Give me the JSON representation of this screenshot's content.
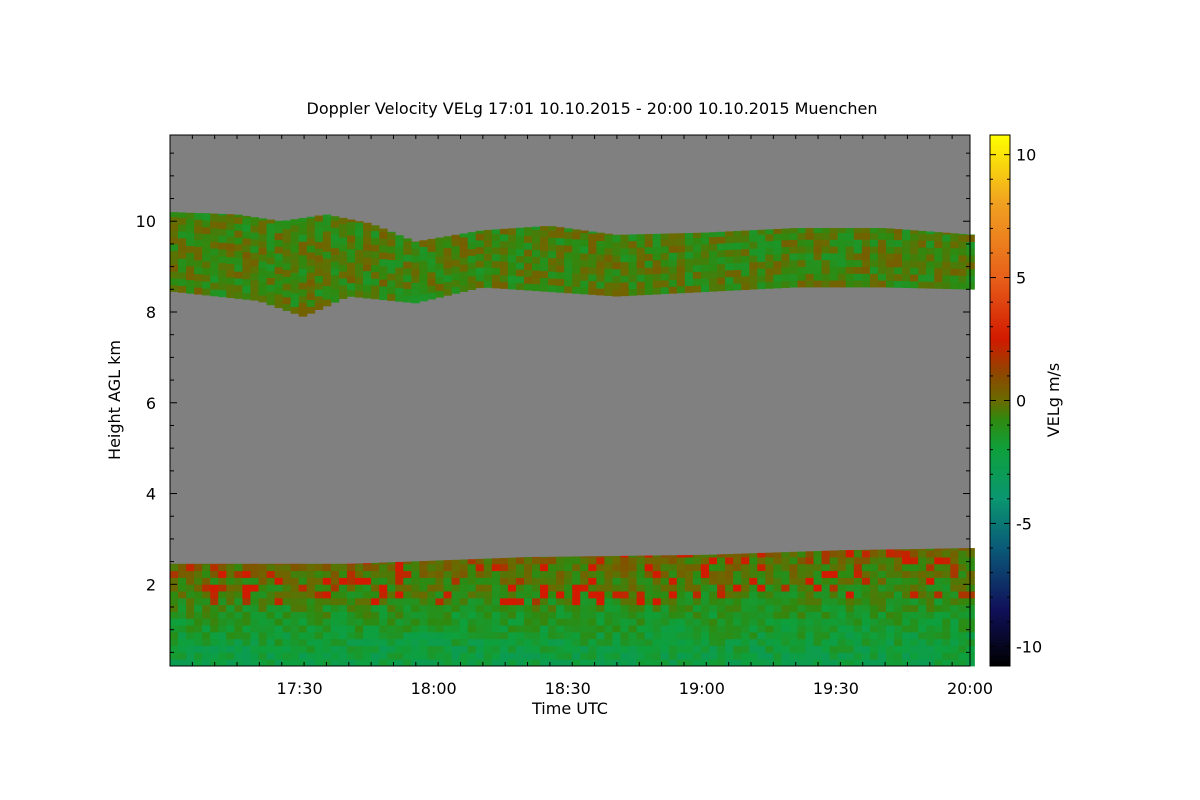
{
  "chart_data": {
    "type": "heatmap",
    "title": "Doppler Velocity VELg   17:01 10.10.2015 - 20:00 10.10.2015 Muenchen",
    "xlabel": "Time UTC",
    "ylabel": "Height AGL km",
    "colorbar_label": "VELg m/s",
    "x_tick_labels": [
      "17:30",
      "18:00",
      "18:30",
      "19:00",
      "19:30",
      "20:00"
    ],
    "x_tick_minutes": [
      1050,
      1080,
      1110,
      1140,
      1170,
      1200
    ],
    "xlim_minutes": [
      1021,
      1200
    ],
    "y_ticks": [
      2,
      4,
      6,
      8,
      10
    ],
    "ylim": [
      0.2,
      11.9
    ],
    "colorbar_ticks": [
      10,
      5,
      0,
      -5,
      -10
    ],
    "colorbar_range": [
      -10.8,
      10.8
    ],
    "colorscale": [
      {
        "v": -10.8,
        "c": "#000000"
      },
      {
        "v": -8.5,
        "c": "#10105a"
      },
      {
        "v": -6.0,
        "c": "#0a5a78"
      },
      {
        "v": -4.0,
        "c": "#0a9670"
      },
      {
        "v": -2.0,
        "c": "#0ea03c"
      },
      {
        "v": -0.8,
        "c": "#2e8a10"
      },
      {
        "v": 0.0,
        "c": "#6a6a00"
      },
      {
        "v": 1.0,
        "c": "#8a4a00"
      },
      {
        "v": 2.5,
        "c": "#d21a00"
      },
      {
        "v": 5.0,
        "c": "#e8601a"
      },
      {
        "v": 8.0,
        "c": "#f0a020"
      },
      {
        "v": 10.8,
        "c": "#ffff00"
      }
    ],
    "no_signal_color": "#808080",
    "layers": [
      {
        "name": "upper cloud band",
        "time_start": 1021,
        "time_end": 1200,
        "bottom_km": [
          [
            1021,
            8.45
          ],
          [
            1040,
            8.25
          ],
          [
            1050,
            7.9
          ],
          [
            1060,
            8.35
          ],
          [
            1075,
            8.2
          ],
          [
            1090,
            8.55
          ],
          [
            1105,
            8.45
          ],
          [
            1120,
            8.35
          ],
          [
            1140,
            8.45
          ],
          [
            1160,
            8.55
          ],
          [
            1180,
            8.55
          ],
          [
            1200,
            8.5
          ]
        ],
        "top_km": [
          [
            1021,
            10.2
          ],
          [
            1035,
            10.15
          ],
          [
            1045,
            10.0
          ],
          [
            1055,
            10.15
          ],
          [
            1065,
            9.95
          ],
          [
            1075,
            9.55
          ],
          [
            1090,
            9.8
          ],
          [
            1105,
            9.9
          ],
          [
            1120,
            9.7
          ],
          [
            1140,
            9.75
          ],
          [
            1160,
            9.85
          ],
          [
            1180,
            9.85
          ],
          [
            1200,
            9.7
          ]
        ],
        "velocity_range": [
          -1.5,
          0.4
        ]
      },
      {
        "name": "boundary layer",
        "time_start": 1021,
        "time_end": 1200,
        "bottom_km": [
          [
            1021,
            0.2
          ],
          [
            1200,
            0.2
          ]
        ],
        "top_km": [
          [
            1021,
            2.45
          ],
          [
            1060,
            2.45
          ],
          [
            1100,
            2.6
          ],
          [
            1140,
            2.65
          ],
          [
            1170,
            2.75
          ],
          [
            1200,
            2.8
          ]
        ],
        "velocity_range": [
          -2.8,
          2.5
        ]
      }
    ]
  }
}
